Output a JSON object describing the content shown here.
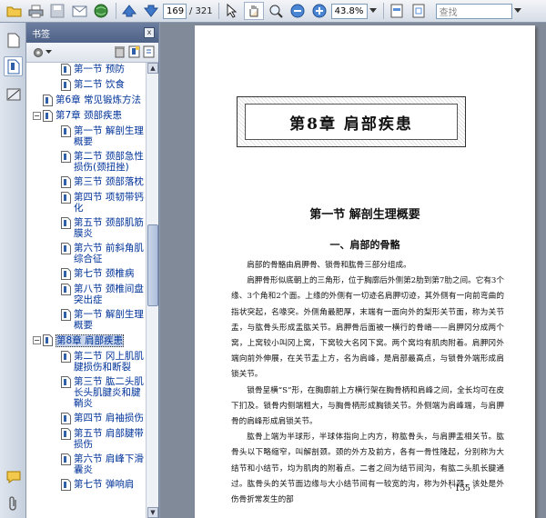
{
  "toolbar": {
    "page_current": "169",
    "page_total": "/ 321",
    "zoom": "43.8%",
    "search_placeholder": "查找"
  },
  "panel": {
    "title": "书签",
    "close": "x",
    "options_label": "选项",
    "items": [
      {
        "label": "第一节 预防",
        "level": 2
      },
      {
        "label": "第二节 饮食",
        "level": 2
      },
      {
        "label": "第6章 常见锻炼方法",
        "level": 1
      },
      {
        "label": "第7章 颈部疾患",
        "level": 1,
        "expander": "−"
      },
      {
        "label": "第一节 解剖生理概要",
        "level": 2
      },
      {
        "label": "第二节 颈部急性损伤(颈扭挫)",
        "level": 2
      },
      {
        "label": "第三节 颈部落枕",
        "level": 2
      },
      {
        "label": "第四节 项韧带钙化",
        "level": 2
      },
      {
        "label": "第五节 颈部肌筋膜炎",
        "level": 2
      },
      {
        "label": "第六节 前斜角肌综合征",
        "level": 2
      },
      {
        "label": "第七节 颈椎病",
        "level": 2
      },
      {
        "label": "第八节 颈椎间盘突出症",
        "level": 2
      },
      {
        "label": "第一节 解剖生理概要",
        "level": 2
      },
      {
        "label": "第8章 肩部疾患",
        "level": 1,
        "expander": "−",
        "selected": true
      },
      {
        "label": "第二节 冈上肌肌腱损伤和断裂",
        "level": 2
      },
      {
        "label": "第三节 肱二头肌长头肌腱炎和腱鞘炎",
        "level": 2
      },
      {
        "label": "第四节 肩袖损伤",
        "level": 2
      },
      {
        "label": "第五节 肩部腱带损伤",
        "level": 2
      },
      {
        "label": "第六节 肩峰下滑囊炎",
        "level": 2
      },
      {
        "label": "第七节 弹响肩",
        "level": 2
      }
    ]
  },
  "document": {
    "chapter_title": "第8章  肩部疾患",
    "section_title": "第一节   解剖生理概要",
    "sub_title": "一、肩部的骨骼",
    "paragraphs": [
      "肩部的骨骼由肩胛骨、锁骨和肱骨三部分组成。",
      "肩胛骨形似底朝上的三角形，位于胸廓后外侧第2肋到第7肋之间。它有3个缘、3个角和2个面。上缘的外侧有一切迹名肩胛切迹，其外侧有一向前弯曲的指状突起，名喙突。外侧角最肥厚，末端有一面向外的梨形关节面，称为关节盂，与肱骨头形成盂肱关节。肩胛骨后面被一横行的骨嵴——肩胛冈分成两个窝，上窝较小叫冈上窝，下窝较大名冈下窝。两个窝均有肌肉附着。肩胛冈外端向前外伸展，在关节盂上方，名为肩峰，是肩部最高点，与锁骨外端形成肩锁关节。",
      "锁骨呈横“S”形，在胸廓前上方横行架在胸骨柄和肩峰之间，全长均可在皮下扪及。锁骨内侧端粗大，与胸骨柄形成胸锁关节。外侧端为肩峰端，与肩胛骨的肩峰形成肩锁关节。",
      "肱骨上端为半球形，半球体指向上内方，称肱骨头，与肩胛盂相关节。肱骨头以下略缩窄，叫解剖颈。颈的外方及前方，各有一骨性隆起，分别称为大结节和小结节，均为肌肉的附着点。二者之间为结节间沟，有肱二头肌长腱通过。肱骨头的关节面边缘与大小结节间有一较宽的沟，称为外科颈，该处是外伤骨折常发生的部"
    ],
    "page_number": "· 155 ·"
  }
}
